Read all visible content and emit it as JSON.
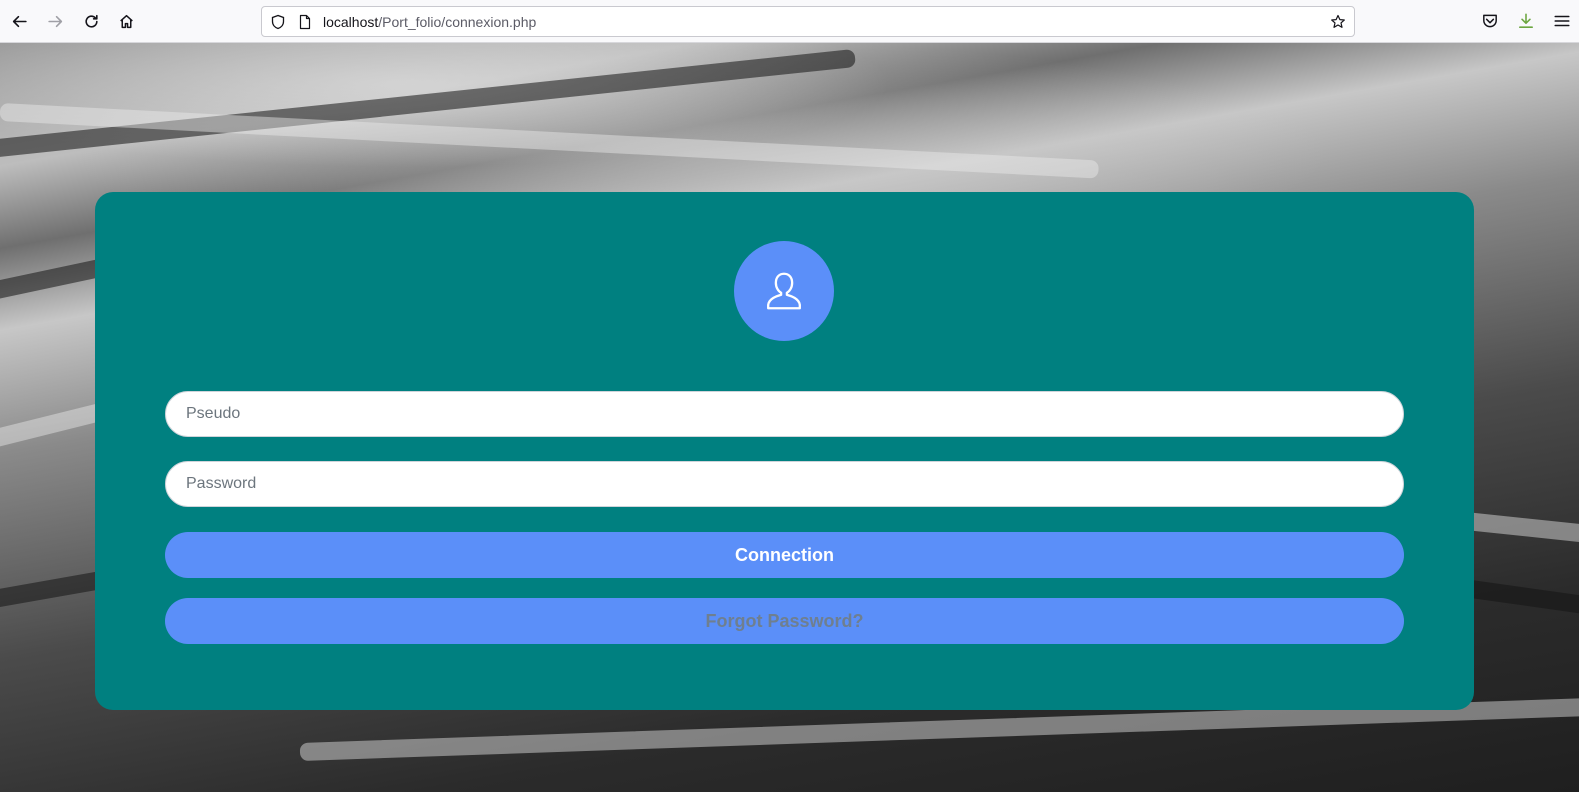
{
  "browser": {
    "url_host": "localhost",
    "url_path": "/Port_folio/connexion.php"
  },
  "form": {
    "pseudo_placeholder": "Pseudo",
    "password_placeholder": "Password",
    "connect_label": "Connection",
    "forgot_label": "Forgot Password?"
  },
  "colors": {
    "card": "#008080",
    "accent": "#5b8ff9"
  }
}
